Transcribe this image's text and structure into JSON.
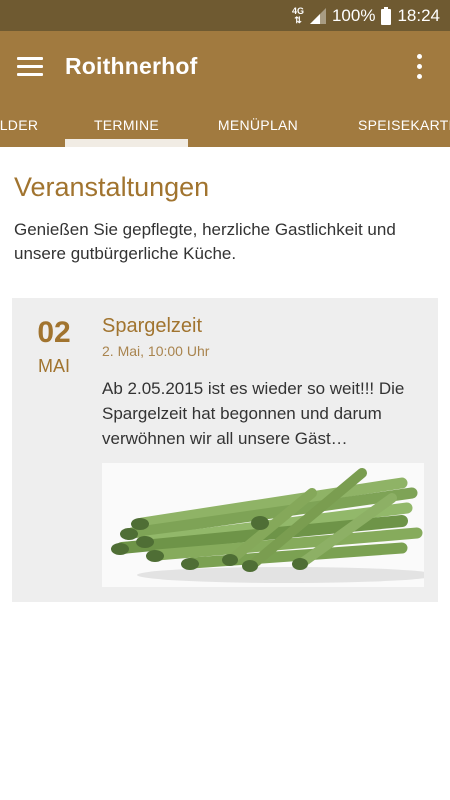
{
  "status_bar": {
    "network": "4G",
    "battery": "100%",
    "time": "18:24"
  },
  "app_bar": {
    "title": "Roithnerhof"
  },
  "tabs": [
    {
      "label": "LDER"
    },
    {
      "label": "TERMINE"
    },
    {
      "label": "MENÜPLAN"
    },
    {
      "label": "SPEISEKARTE"
    }
  ],
  "main": {
    "title": "Veranstaltungen",
    "intro": "Genießen Sie gepflegte, herzliche Gastlichkeit und unsere gutbürgerliche Küche."
  },
  "events": [
    {
      "day": "02",
      "month": "MAI",
      "title": "Spargelzeit",
      "datetime": "2. Mai, 10:00 Uhr",
      "text": "Ab 2.05.2015 ist es wieder so weit!!! Die Spargelzeit hat begonnen und darum verwöhnen wir all unsere Gäst…",
      "image": "green-asparagus-bundle"
    }
  ],
  "colors": {
    "status_bar": "#6f5a31",
    "app_bar": "#a17a3f",
    "accent_text": "#a1742f",
    "card_background": "#eeeeee"
  }
}
